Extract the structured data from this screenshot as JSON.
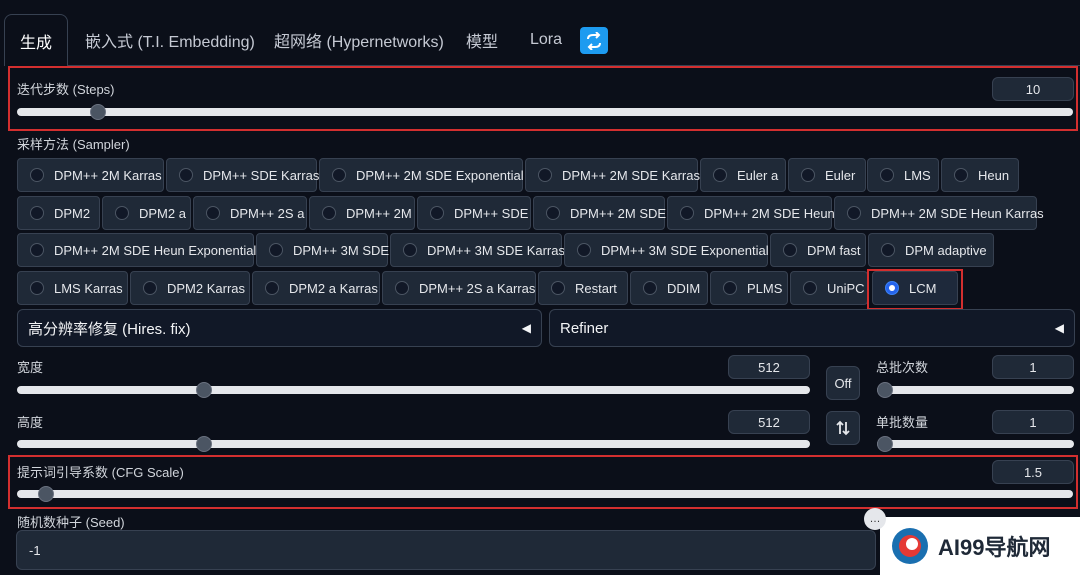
{
  "tabs": [
    {
      "label": "生成"
    },
    {
      "label": "嵌入式 (T.I. Embedding)"
    },
    {
      "label": "超网络 (Hypernetworks)"
    },
    {
      "label": "模型"
    },
    {
      "label": "Lora"
    }
  ],
  "steps": {
    "label": "迭代步数 (Steps)",
    "value": "10",
    "fraction": 0.07
  },
  "sampler": {
    "label": "采样方法 (Sampler)",
    "options": [
      "DPM++ 2M Karras",
      "DPM++ SDE Karras",
      "DPM++ 2M SDE Exponential",
      "DPM++ 2M SDE Karras",
      "Euler a",
      "Euler",
      "LMS",
      "Heun",
      "DPM2",
      "DPM2 a",
      "DPM++ 2S a",
      "DPM++ 2M",
      "DPM++ SDE",
      "DPM++ 2M SDE",
      "DPM++ 2M SDE Heun",
      "DPM++ 2M SDE Heun Karras",
      "DPM++ 2M SDE Heun Exponential",
      "DPM++ 3M SDE",
      "DPM++ 3M SDE Karras",
      "DPM++ 3M SDE Exponential",
      "DPM fast",
      "DPM adaptive",
      "LMS Karras",
      "DPM2 Karras",
      "DPM2 a Karras",
      "DPM++ 2S a Karras",
      "Restart",
      "DDIM",
      "PLMS",
      "UniPC",
      "LCM"
    ],
    "selected": "LCM"
  },
  "hires": {
    "label": "高分辨率修复 (Hires. fix)"
  },
  "refiner": {
    "label": "Refiner"
  },
  "width": {
    "label": "宽度",
    "value": "512",
    "fraction": 0.23
  },
  "height": {
    "label": "高度",
    "value": "512",
    "fraction": 0.23
  },
  "off_button": {
    "label": "Off"
  },
  "batch_count": {
    "label": "总批次数",
    "value": "1",
    "fraction": 0.0
  },
  "batch_size": {
    "label": "单批数量",
    "value": "1",
    "fraction": 0.0
  },
  "cfg": {
    "label": "提示词引导系数 (CFG Scale)",
    "value": "1.5",
    "fraction": 0.02
  },
  "seed": {
    "label": "随机数种子 (Seed)",
    "value": "-1"
  },
  "watermark": {
    "text": "AI99导航网"
  },
  "icons": {
    "refresh": "refresh-icon",
    "swap": "swap-icon",
    "triangle": "triangle-left-icon",
    "chat": "chat-icon",
    "logo": "ai99-logo-icon"
  },
  "colors": {
    "accent": "#1d9bf0",
    "highlight": "#d32f2f",
    "background": "#0b0f19"
  }
}
